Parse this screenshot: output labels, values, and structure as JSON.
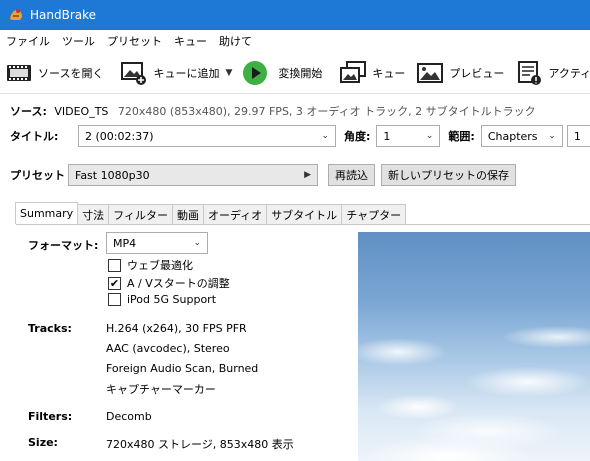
{
  "window": {
    "title": "HandBrake"
  },
  "menu": [
    "ファイル",
    "ツール",
    "プリセット",
    "キュー",
    "助けて"
  ],
  "toolbar": {
    "open_source": "ソースを開く",
    "add_to_queue": "キューに追加",
    "start": "変換開始",
    "queue": "キュー",
    "preview": "プレビュー",
    "activity": "アクティビ"
  },
  "source": {
    "label": "ソース:",
    "name": "VIDEO_TS",
    "info": "720x480 (853x480), 29.97 FPS, 3 オーディオ トラック, 2 サブタイトルトラック"
  },
  "title_row": {
    "title_label": "タイトル:",
    "title_value": "2 (00:02:37)",
    "angle_label": "角度:",
    "angle_value": "1",
    "range_label": "範囲:",
    "range_type": "Chapters",
    "range_start": "1"
  },
  "preset_row": {
    "label": "プリセット",
    "value": "Fast 1080p30",
    "reload": "再読込",
    "save_new": "新しいプリセットの保存"
  },
  "tabs": [
    "Summary",
    "寸法",
    "フィルター",
    "動画",
    "オーディオ",
    "サブタイトル",
    "チャプター"
  ],
  "summary": {
    "format_label": "フォーマット:",
    "format_value": "MP4",
    "web_optimized": {
      "label": "ウェブ最適化",
      "checked": false
    },
    "av_align": {
      "label": "A / Vスタートの調整",
      "checked": true
    },
    "ipod": {
      "label": "iPod 5G Support",
      "checked": false
    },
    "tracks_label": "Tracks:",
    "tracks": [
      "H.264 (x264), 30 FPS PFR",
      "AAC (avcodec), Stereo",
      "Foreign Audio Scan, Burned",
      "キャプチャーマーカー"
    ],
    "filters_label": "Filters:",
    "filters_value": "Decomb",
    "size_label": "Size:",
    "size_value": "720x480 ストレージ, 853x480 表示"
  }
}
